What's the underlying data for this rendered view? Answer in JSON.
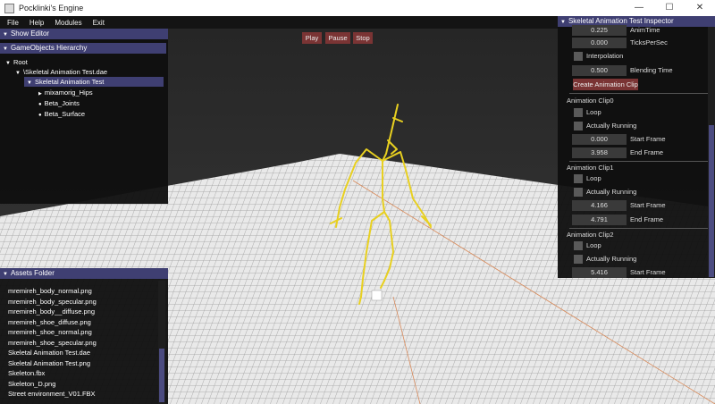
{
  "window": {
    "title": "Pocklinki's Engine",
    "minimize": "—",
    "maximize": "☐",
    "close": "✕"
  },
  "menu": [
    "File",
    "Help",
    "Modules",
    "Exit"
  ],
  "playback": {
    "play": "Play",
    "pause": "Pause",
    "stop": "Stop"
  },
  "editor": {
    "title": "Show Editor",
    "hierarchy_title": "GameObjects Hierarchy",
    "tree": [
      "Root",
      "\\Skeletal Animation Test.dae",
      "Skeletal Animation Test",
      "mixamorig_Hips",
      "Beta_Joints",
      "Beta_Surface"
    ]
  },
  "assets": {
    "title": "Assets Folder",
    "files": [
      "mremireh_body_normal.png",
      "mremireh_body_specular.png",
      "mremireh_body__diffuse.png",
      "mremireh_shoe_diffuse.png",
      "mremireh_shoe_normal.png",
      "mremireh_shoe_specular.png",
      "Skeletal Animation Test.dae",
      "Skeletal Animation Test.png",
      "Skeleton.fbx",
      "Skeleton_D.png",
      "Street environment_V01.FBX"
    ]
  },
  "inspector": {
    "title": "Skeletal Animation Test Inspector",
    "anim_time_value": "0.225",
    "anim_time_label": "AnimTime",
    "ticks_value": "0.000",
    "ticks_label": "TicksPerSec",
    "interpolation_label": "Interpolation",
    "blending_value": "0.500",
    "blending_label": "Blending Time",
    "create_clip": "Create Animation Clip",
    "loop_label": "Loop",
    "running_label": "Actually Running",
    "start_label": "Start Frame",
    "end_label": "End Frame",
    "clips": [
      {
        "name": "Animation Clip0",
        "start": "0.000",
        "end": "3.958"
      },
      {
        "name": "Animation Clip1",
        "start": "4.166",
        "end": "4.791"
      },
      {
        "name": "Animation Clip2",
        "start": "5.416"
      }
    ]
  },
  "colors": {
    "panel_header": "#3f3f72",
    "button": "#7a3434",
    "skeleton": "#e8d020"
  }
}
